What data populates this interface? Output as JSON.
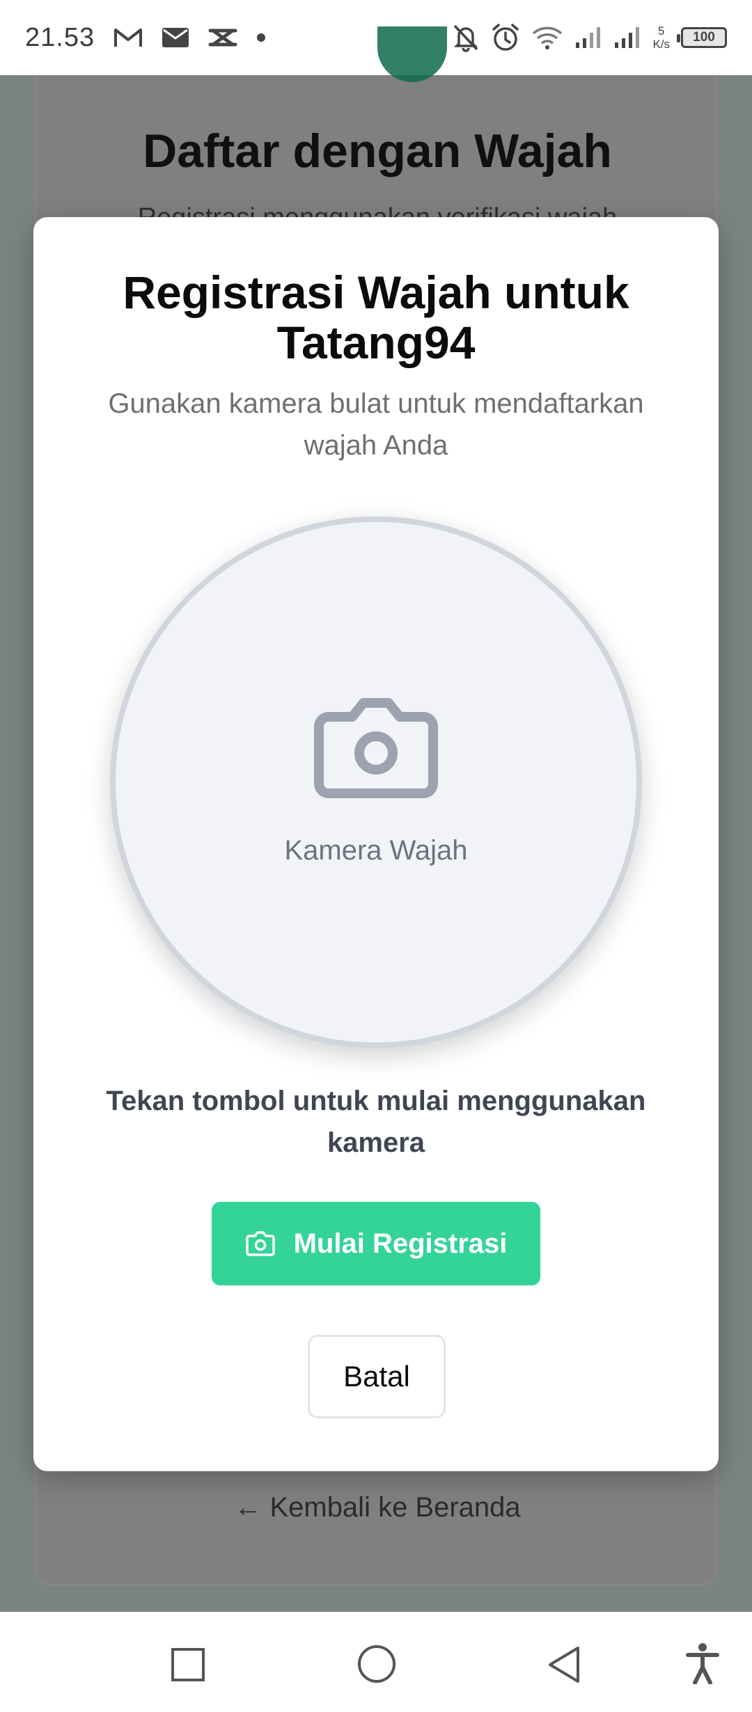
{
  "status_bar": {
    "time": "21.53",
    "net_speed_value": "5",
    "net_speed_unit": "K/s",
    "battery": "100",
    "icons": [
      "gmail-icon",
      "mail-icon",
      "capcut-icon",
      "dot-icon",
      "bell-off-icon",
      "alarm-icon",
      "wifi-icon",
      "signal-icon",
      "signal-icon"
    ]
  },
  "background_page": {
    "title": "Daftar dengan Wajah",
    "subtitle": "Registrasi menggunakan verifikasi wajah",
    "back_link": "← Kembali ke Beranda"
  },
  "modal": {
    "title": "Registrasi Wajah untuk Tatang94",
    "subtitle": "Gunakan kamera bulat untuk mendaftarkan wajah Anda",
    "camera_label": "Kamera Wajah",
    "instruction": "Tekan tombol untuk mulai menggunakan kamera",
    "start_button": "Mulai Registrasi",
    "cancel_button": "Batal"
  },
  "colors": {
    "accent_green": "#34d399",
    "overlay": "#7b8480",
    "camera_border": "#d1d5dc"
  },
  "nav_bar": {
    "icons": [
      "recent-apps-icon",
      "home-icon",
      "back-icon",
      "accessibility-icon"
    ]
  }
}
